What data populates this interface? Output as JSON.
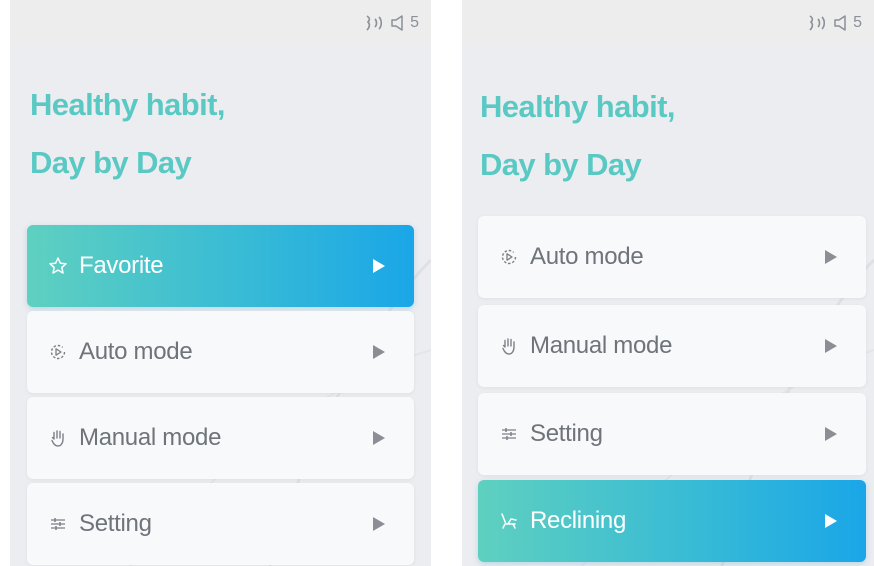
{
  "left_screen": {
    "status": {
      "voice_icon": "voice-wave-icon",
      "volume_icon": "speaker-icon",
      "volume_level": "5"
    },
    "headline": {
      "line1": "Healthy habit,",
      "line2": "Day by Day"
    },
    "menu": [
      {
        "label": "Favorite",
        "icon": "star-icon",
        "active": true
      },
      {
        "label": "Auto mode",
        "icon": "auto-play-icon",
        "active": false
      },
      {
        "label": "Manual mode",
        "icon": "hand-icon",
        "active": false
      },
      {
        "label": "Setting",
        "icon": "sliders-icon",
        "active": false
      }
    ]
  },
  "right_screen": {
    "status": {
      "voice_icon": "voice-wave-icon",
      "volume_icon": "speaker-icon",
      "volume_level": "5"
    },
    "headline": {
      "line1": "Healthy habit,",
      "line2": "Day by Day"
    },
    "menu": [
      {
        "label": "Auto mode",
        "icon": "auto-play-icon",
        "active": false
      },
      {
        "label": "Manual mode",
        "icon": "hand-icon",
        "active": false
      },
      {
        "label": "Setting",
        "icon": "sliders-icon",
        "active": false
      },
      {
        "label": "Reclining",
        "icon": "recline-icon",
        "active": true
      }
    ]
  },
  "colors": {
    "headline": "#5ac9c4",
    "active_gradient_start": "#5fd0c0",
    "active_gradient_end": "#1aa6e8",
    "inactive_text": "#6f737a",
    "background": "#ecedf0"
  }
}
